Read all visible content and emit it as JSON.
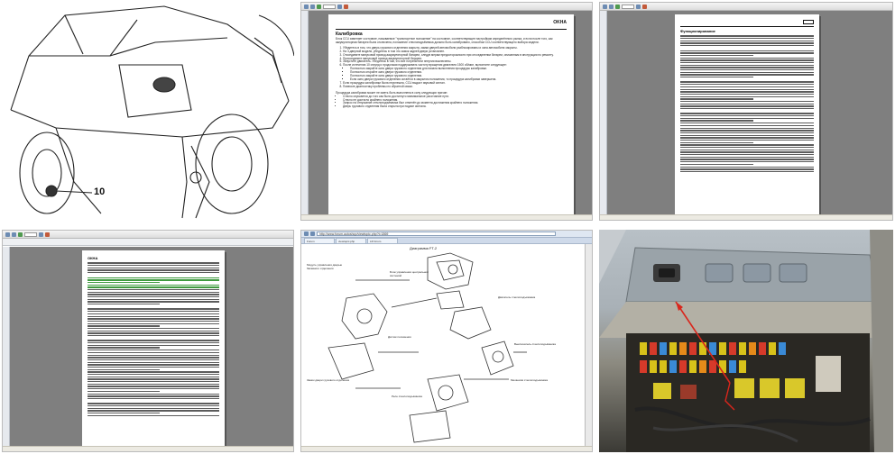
{
  "cells": {
    "drawing": {
      "callout_label": "10"
    },
    "calibration_page": {
      "header_tag": "OKHA",
      "heading": "Калибровка",
      "intro": "Блок CCU изменяет состояние, называемое \"транспортное положение\" на состояние, соответствующее настройкам определённого рынка, и если после того, как аккумуляторная батарея была отключена, положение стеклоподъёмника должно быть калибровано, способом CCU соответствующего выбора модели.",
      "steps": [
        "Убедитесь в том, что дверь грузового отделения закрыта, замки дверей автомобиля разблокированы и окна автомобиля закрыты.",
        "На 3-дверной модели, убедитесь в том что замок задней двери установлен.",
        "Отсоедините минусовой провод аккумуляторной батареи, следуя мерам предосторожности при отсоединении батареи, описанным в инструкции по ремонту.",
        "Присоедините минусовой провод аккумуляторной батареи.",
        "Запустите двигатель. Убедитесь в том, что все потребители энергии выключены.",
        "После истечения 10 секунд и продолжая поддерживать частоту вращения двигателя 1500 об/мин, выполните следующее:",
        "Если процедура калибровки была неуспешна, CCU выдаст звуковой сигнал.",
        "Повесьте диагностику проблемы по обратной связи."
      ],
      "substeps": [
        "Полностью закройте окно двери грузового отделения для начала выполнения процедуры калибровки.",
        "Полностью откройте окно двери грузового отделения.",
        "Полностью закройте окно двери грузового отделения.",
        "Если окно двери грузового отделения остаётся в закрытом положении, то процедура калибровки завершена."
      ],
      "note_intro": "Процедура калибровки может не иметь быть выполнена в силу следующих причин:",
      "bullets": [
        "Стекло опускается до того как было достигнуто минимальное расстояние пути.",
        "Стекло не достигло крайнего положения.",
        "Запрос на отпускание стеклоподъёмника был отменён до момента достижения крайнего положения.",
        "Дверь грузового отделения была открыта при подаче сигнала."
      ]
    },
    "function_page": {
      "heading": "Функционирование"
    },
    "document_page": {
      "heading": "ОКНА"
    },
    "browser_page": {
      "url": "http://www.forum.autoshop/viewtopic.php?t=1869",
      "tabs": [
        "Forum",
        "viewtopic.php",
        "LR forum"
      ],
      "diagram_title": "Диаграмма FT-2",
      "callouts": [
        "Модуль управления дверью багажного отделения",
        "Блок управления центральной системой",
        "Двигатель стеклоподъёмника",
        "Датчик положения",
        "Выключатель стеклоподъёмника",
        "Замок двери грузового отделения",
        "Механизм стеклоподъёмника",
        "Реле стеклоподъёмника"
      ]
    }
  },
  "colors": {
    "viewer_gray": "#7f7f7f",
    "highlight_green": "#3f9a3f",
    "photo_arrow": "#d9261c"
  }
}
